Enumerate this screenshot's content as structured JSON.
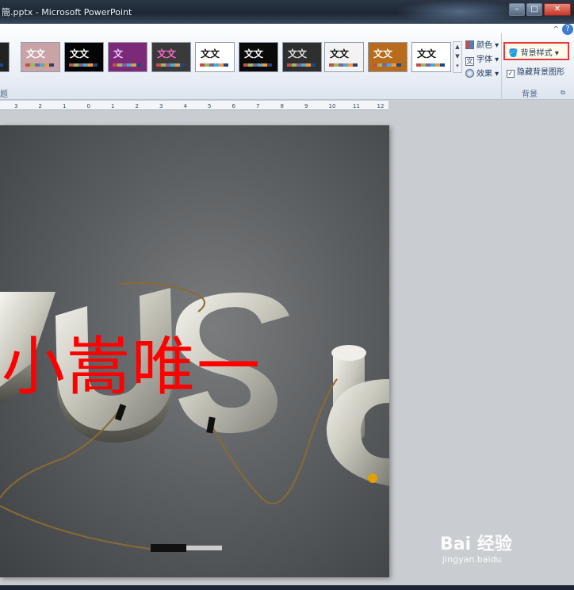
{
  "window": {
    "title": "簡.pptx - Microsoft PowerPoint",
    "buttons": [
      "–",
      "□",
      "✕"
    ]
  },
  "ribbon": {
    "gallery_items": [
      {
        "text": "",
        "bg": "#222222",
        "fg": "#ffffff"
      },
      {
        "text": "文文",
        "bg": "#caa3a7",
        "fg": "#ffffff"
      },
      {
        "text": "文文",
        "bg": "#050505",
        "fg": "#ffffff"
      },
      {
        "text": "文",
        "bg": "#7c2a78",
        "fg": "#e9c9ff"
      },
      {
        "text": "文文",
        "bg": "#3a3a3a",
        "fg": "#ff66cc"
      },
      {
        "text": "文文",
        "bg": "#ffffff",
        "fg": "#111111"
      },
      {
        "text": "文文",
        "bg": "#0a0a0a",
        "fg": "#ffffff"
      },
      {
        "text": "文文",
        "bg": "#2f2f2f",
        "fg": "#dddddd"
      },
      {
        "text": "文文",
        "bg": "#f3f3f3",
        "fg": "#111111"
      },
      {
        "text": "文文",
        "bg": "#b86b1a",
        "fg": "#ffffff"
      },
      {
        "text": "文文",
        "bg": "#ffffff",
        "fg": "#111111"
      }
    ],
    "theme_options": [
      "颜色",
      "字体",
      "效果"
    ],
    "background_styles_label": "背景样式",
    "hide_background_label": "隐藏背景图形",
    "group_label_themes": "题",
    "group_label_background": "背景",
    "help_icon": "?",
    "expand_icon": "^"
  },
  "ruler": {
    "ticks": [
      "3",
      "2",
      "1",
      "0",
      "1",
      "2",
      "3",
      "4",
      "5",
      "6",
      "7",
      "8",
      "9",
      "10",
      "11",
      "12"
    ]
  },
  "slide": {
    "text": "小嵩唯一",
    "text_color": "#ff0000",
    "image_subject": "3D metallic MUSIC letters with audio cables"
  },
  "watermark": {
    "brand": "Bai 经验",
    "url": "jingyan.baidu"
  }
}
